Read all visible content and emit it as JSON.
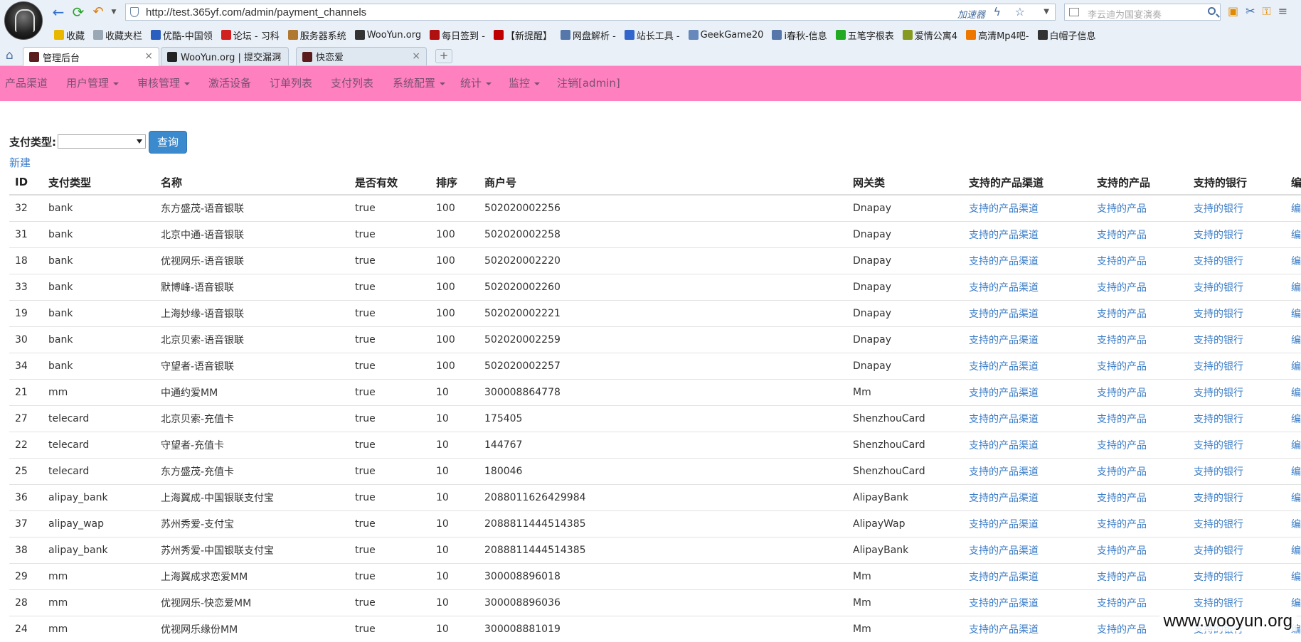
{
  "browser": {
    "url": "http://test.365yf.com/admin/payment_channels",
    "accelerator_label": "加速器",
    "search_placeholder": "李云迪为国宴演奏",
    "bookmarks": [
      {
        "label": "收藏",
        "color": "#e8b800"
      },
      {
        "label": "收藏夹栏",
        "color": "#9aa7b5"
      },
      {
        "label": "优酷-中国领",
        "color": "#2a5fbf"
      },
      {
        "label": "论坛 - 习科",
        "color": "#d02020"
      },
      {
        "label": "服务器系统",
        "color": "#b07830"
      },
      {
        "label": "WooYun.org",
        "color": "#333333"
      },
      {
        "label": "每日签到 -",
        "color": "#b01010"
      },
      {
        "label": "【新提醒】",
        "color": "#c00000"
      },
      {
        "label": "网盘解析 -",
        "color": "#5577aa"
      },
      {
        "label": "站长工具 -",
        "color": "#3366cc"
      },
      {
        "label": "GeekGame20",
        "color": "#6688bb"
      },
      {
        "label": "i春秋-信息",
        "color": "#5577aa"
      },
      {
        "label": "五笔字根表",
        "color": "#22aa22"
      },
      {
        "label": "爱情公寓4",
        "color": "#889922"
      },
      {
        "label": "高清Mp4吧-",
        "color": "#ee7700"
      },
      {
        "label": "白帽子信息",
        "color": "#333333"
      }
    ],
    "tabs": [
      {
        "label": "管理后台",
        "active": true
      },
      {
        "label": "WooYun.org | 提交漏洞",
        "active": false
      },
      {
        "label": "快恋爱",
        "active": false
      }
    ],
    "new_tab_label": "+",
    "close_glyph": "×"
  },
  "navbar": {
    "color": "#ff80bf",
    "items": [
      {
        "label": "产品渠道",
        "dropdown": false
      },
      {
        "label": "用户管理",
        "dropdown": true
      },
      {
        "label": "审核管理",
        "dropdown": true
      },
      {
        "label": "激活设备",
        "dropdown": false
      },
      {
        "label": "订单列表",
        "dropdown": false
      },
      {
        "label": "支付列表",
        "dropdown": false
      },
      {
        "label": "系统配置",
        "dropdown": true
      },
      {
        "label": "统计",
        "dropdown": true
      },
      {
        "label": "监控",
        "dropdown": true
      },
      {
        "label": "注销[admin]",
        "dropdown": false
      }
    ]
  },
  "filter": {
    "label": "支付类型:",
    "select_value": "",
    "button_label": "查询"
  },
  "new_link": "新建",
  "table": {
    "columns": [
      "ID",
      "支付类型",
      "名称",
      "是否有效",
      "排序",
      "商户号",
      "网关类",
      "支持的产品渠道",
      "支持的产品",
      "支持的银行",
      "编"
    ],
    "link_labels": {
      "channels": "支持的产品渠道",
      "products": "支持的产品",
      "banks": "支持的银行",
      "edit": "编"
    },
    "rows": [
      {
        "id": "32",
        "type": "bank",
        "name": "东方盛茂-语音银联",
        "valid": "true",
        "sort": "100",
        "merchant": "502020002256",
        "gateway": "Dnapay"
      },
      {
        "id": "31",
        "type": "bank",
        "name": "北京中通-语音银联",
        "valid": "true",
        "sort": "100",
        "merchant": "502020002258",
        "gateway": "Dnapay"
      },
      {
        "id": "18",
        "type": "bank",
        "name": "优视网乐-语音银联",
        "valid": "true",
        "sort": "100",
        "merchant": "502020002220",
        "gateway": "Dnapay"
      },
      {
        "id": "33",
        "type": "bank",
        "name": "默博峰-语音银联",
        "valid": "true",
        "sort": "100",
        "merchant": "502020002260",
        "gateway": "Dnapay"
      },
      {
        "id": "19",
        "type": "bank",
        "name": "上海妙缘-语音银联",
        "valid": "true",
        "sort": "100",
        "merchant": "502020002221",
        "gateway": "Dnapay"
      },
      {
        "id": "30",
        "type": "bank",
        "name": "北京贝索-语音银联",
        "valid": "true",
        "sort": "100",
        "merchant": "502020002259",
        "gateway": "Dnapay"
      },
      {
        "id": "34",
        "type": "bank",
        "name": "守望者-语音银联",
        "valid": "true",
        "sort": "100",
        "merchant": "502020002257",
        "gateway": "Dnapay"
      },
      {
        "id": "21",
        "type": "mm",
        "name": "中通约爱MM",
        "valid": "true",
        "sort": "10",
        "merchant": "300008864778",
        "gateway": "Mm"
      },
      {
        "id": "27",
        "type": "telecard",
        "name": "北京贝索-充值卡",
        "valid": "true",
        "sort": "10",
        "merchant": "175405",
        "gateway": "ShenzhouCard"
      },
      {
        "id": "22",
        "type": "telecard",
        "name": "守望者-充值卡",
        "valid": "true",
        "sort": "10",
        "merchant": "144767",
        "gateway": "ShenzhouCard"
      },
      {
        "id": "25",
        "type": "telecard",
        "name": "东方盛茂-充值卡",
        "valid": "true",
        "sort": "10",
        "merchant": "180046",
        "gateway": "ShenzhouCard"
      },
      {
        "id": "36",
        "type": "alipay_bank",
        "name": "上海翼成-中国银联支付宝",
        "valid": "true",
        "sort": "10",
        "merchant": "2088011626429984",
        "gateway": "AlipayBank"
      },
      {
        "id": "37",
        "type": "alipay_wap",
        "name": "苏州秀爱-支付宝",
        "valid": "true",
        "sort": "10",
        "merchant": "2088811444514385",
        "gateway": "AlipayWap"
      },
      {
        "id": "38",
        "type": "alipay_bank",
        "name": "苏州秀爱-中国银联支付宝",
        "valid": "true",
        "sort": "10",
        "merchant": "2088811444514385",
        "gateway": "AlipayBank"
      },
      {
        "id": "29",
        "type": "mm",
        "name": "上海翼成求恋爱MM",
        "valid": "true",
        "sort": "10",
        "merchant": "300008896018",
        "gateway": "Mm"
      },
      {
        "id": "28",
        "type": "mm",
        "name": "优视网乐-快恋爱MM",
        "valid": "true",
        "sort": "10",
        "merchant": "300008896036",
        "gateway": "Mm"
      },
      {
        "id": "24",
        "type": "mm",
        "name": "优视网乐缘份MM",
        "valid": "true",
        "sort": "10",
        "merchant": "300008881019",
        "gateway": "Mm"
      }
    ]
  },
  "watermark": "www.wooyun.org"
}
